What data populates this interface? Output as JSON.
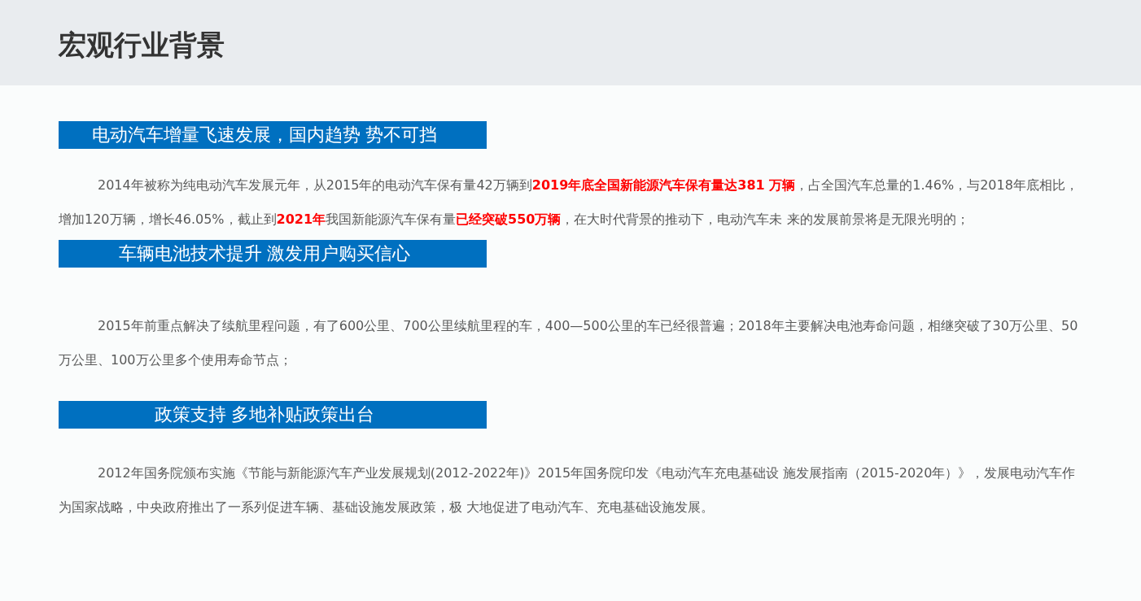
{
  "title": "宏观行业背景",
  "sections": [
    {
      "heading": "电动汽车增量飞速发展，国内趋势 势不可挡",
      "text": "2014年被称为纯电动汽车发展元年，从2015年的电动汽车保有量42万辆到**2019年底全国新能源汽车保有量达381  万辆**，占全国汽车总量的1.46%，与2018年底相比，增加120万辆，增长46.05%，截止到**2021年**我国新能源汽车保有量**已经突破550万辆**，在大时代背景的推动下，电动汽车未 来的发展前景将是无限光明的；"
    },
    {
      "heading": "车辆电池技术提升 激发用户购买信心",
      "text": "2015年前重点解决了续航里程问题，有了600公里、700公里续航里程的车，400—500公里的车已经很普遍；2018年主要解决电池寿命问题，相继突破了30万公里、50万公里、100万公里多个使用寿命节点；"
    },
    {
      "heading": "政策支持 多地补贴政策出台",
      "text": "2012年国务院颁布实施《节能与新能源汽车产业发展规划(2012-2022年)》2015年国务院印发《电动汽车充电基础设 施发展指南（2015-2020年）》，发展电动汽车作为国家战略，中央政府推出了一系列促进车辆、基础设施发展政策，极 大地促进了电动汽车、充电基础设施发展。"
    }
  ]
}
